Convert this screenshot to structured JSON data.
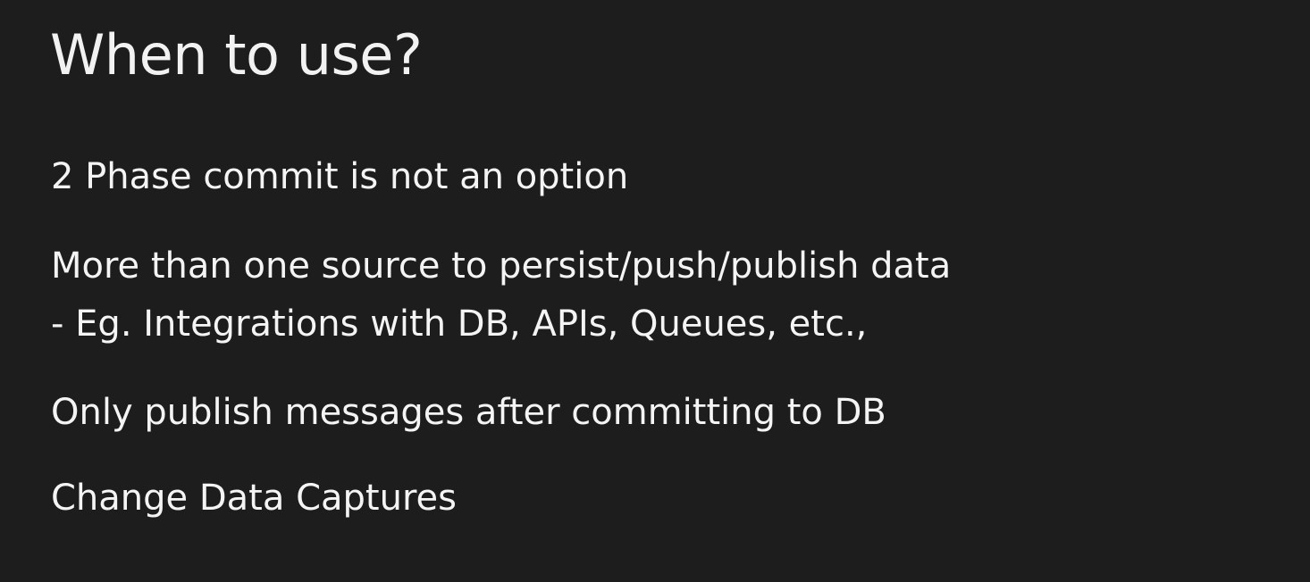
{
  "slide": {
    "title": "When to use?",
    "points": [
      "2 Phase commit is not an option",
      "More than one source to persist/push/publish data",
      "- Eg. Integrations with DB, APIs, Queues, etc.,",
      "Only publish messages after committing to DB",
      "Change Data Captures"
    ]
  },
  "colors": {
    "background": "#1d1d1d",
    "text": "#f4f4f4"
  }
}
